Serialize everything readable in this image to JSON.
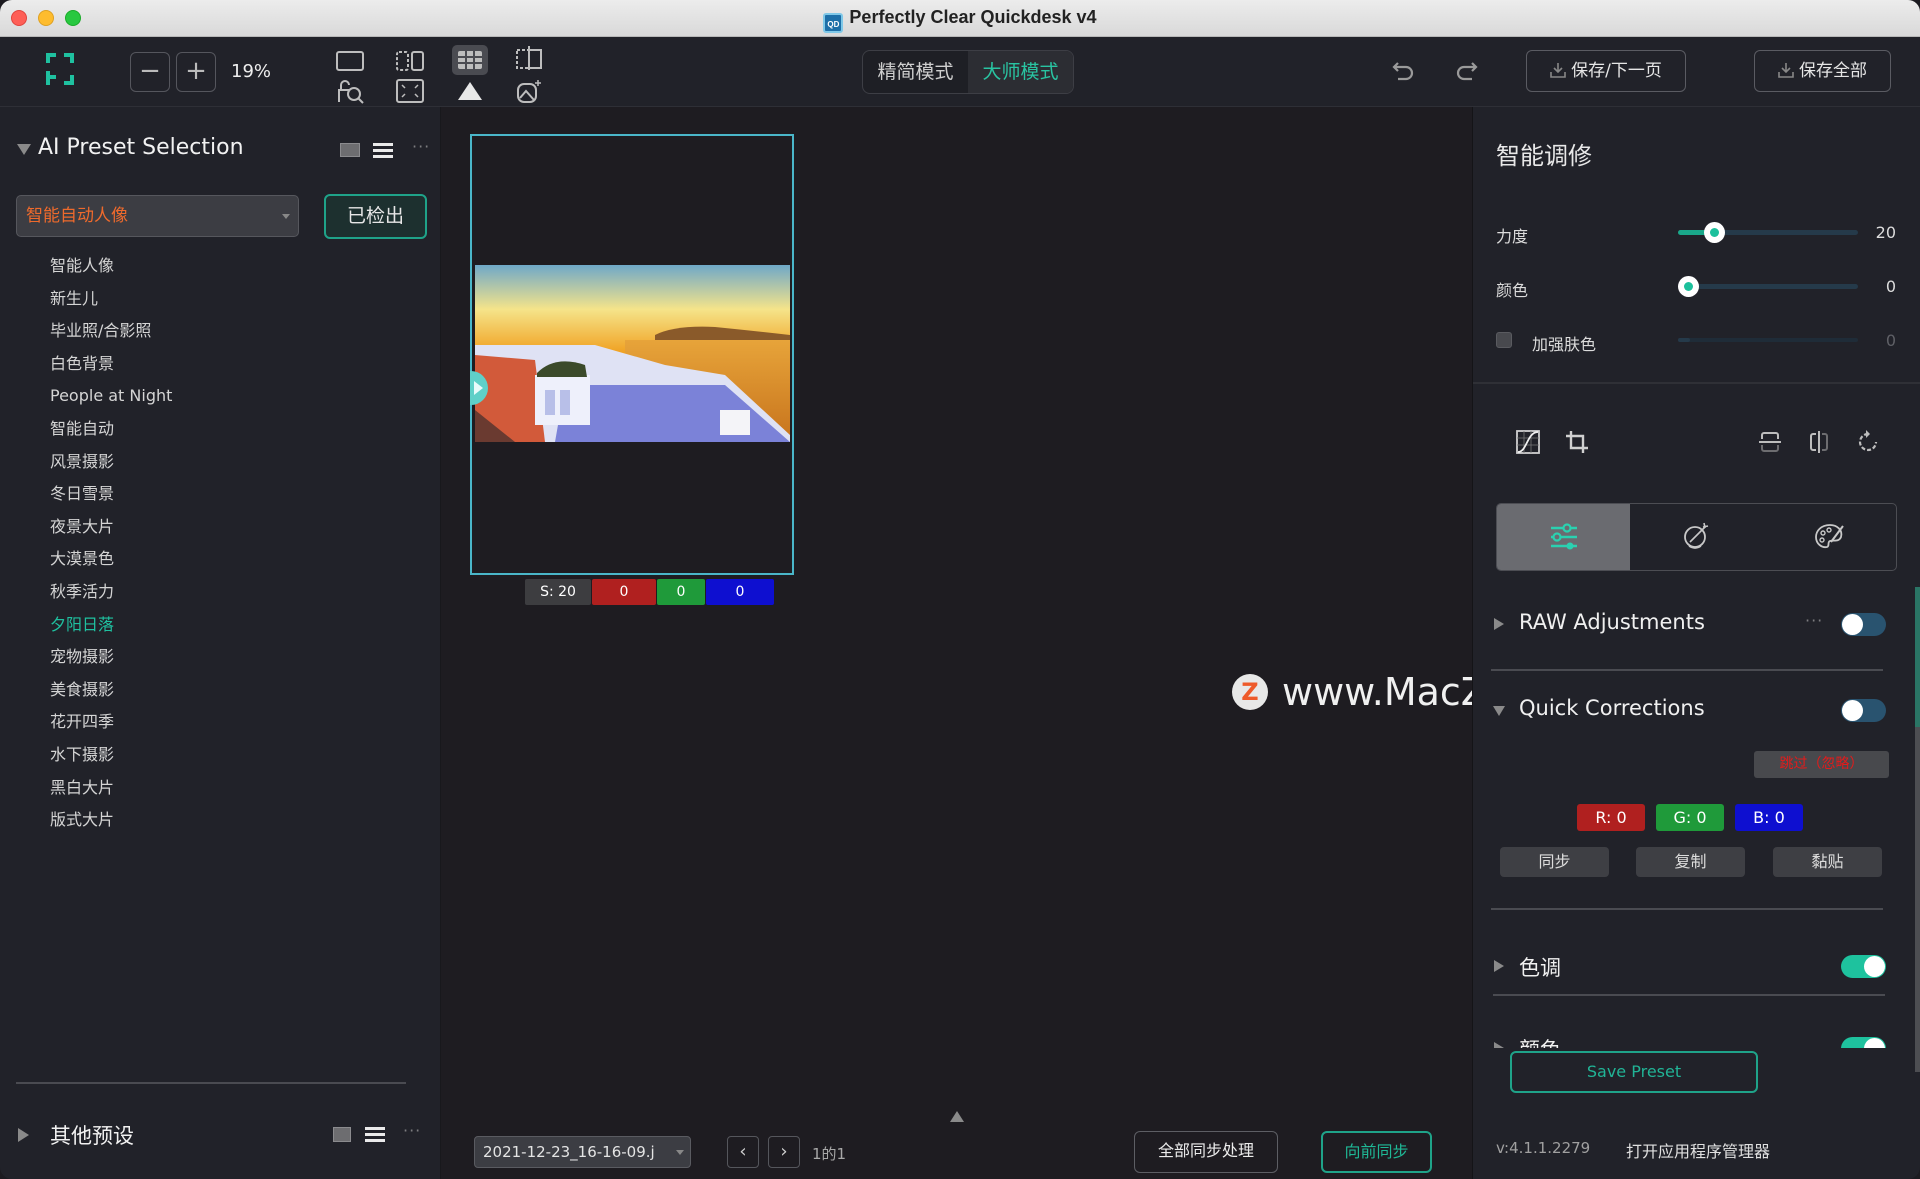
{
  "window": {
    "title": "Perfectly Clear Quickdesk v4",
    "app_icon_text": "QD"
  },
  "toolbar": {
    "zoom_out_label": "−",
    "zoom_in_label": "+",
    "zoom_level": "19%",
    "view_icons": [
      "single-view-icon",
      "compare-view-icon",
      "grid-view-icon",
      "crop-view-icon"
    ],
    "view_sub_icons": [
      "lock-search-icon",
      "fullscreen-icon",
      "triangle-up-icon",
      "image-magic-icon"
    ],
    "modes": [
      {
        "label": "精简模式",
        "active": false
      },
      {
        "label": "大师模式",
        "active": true
      }
    ],
    "undo_icon": "undo-icon",
    "redo_icon": "redo-icon",
    "save_next_label": "保存/下一页",
    "save_all_label": "保存全部"
  },
  "left_panel": {
    "title": "AI Preset Selection",
    "selected_preset": "智能自动人像",
    "detect_button": "已检出",
    "presets": [
      {
        "label": "智能人像",
        "active": false
      },
      {
        "label": "新生儿",
        "active": false
      },
      {
        "label": "毕业照/合影照",
        "active": false
      },
      {
        "label": "白色背景",
        "active": false
      },
      {
        "label": "People at Night",
        "active": false
      },
      {
        "label": "智能自动",
        "active": false
      },
      {
        "label": "风景摄影",
        "active": false
      },
      {
        "label": "冬日雪景",
        "active": false
      },
      {
        "label": "夜景大片",
        "active": false
      },
      {
        "label": "大漠景色",
        "active": false
      },
      {
        "label": "秋季活力",
        "active": false
      },
      {
        "label": "夕阳日落",
        "active": true
      },
      {
        "label": "宠物摄影",
        "active": false
      },
      {
        "label": "美食摄影",
        "active": false
      },
      {
        "label": "花开四季",
        "active": false
      },
      {
        "label": "水下摄影",
        "active": false
      },
      {
        "label": "黑白大片",
        "active": false
      },
      {
        "label": "版式大片",
        "active": false
      }
    ],
    "more_label": "···",
    "other_title": "其他预设"
  },
  "center": {
    "badges": [
      {
        "label": "S: 20",
        "color": "#3d3d40"
      },
      {
        "label": "0",
        "color": "#b0201f"
      },
      {
        "label": "0",
        "color": "#1f9a3a"
      },
      {
        "label": "0",
        "color": "#0e0fd0"
      }
    ],
    "watermark_icon": "Z",
    "watermark_text": "www.MacZ.com",
    "file_name": "2021-12-23_16-16-09.j",
    "prev_label": "‹",
    "next_label": "›",
    "page_info": "1的1",
    "sync_all_label": "全部同步处理",
    "sync_forward_label": "向前同步"
  },
  "right_panel": {
    "title": "智能调修",
    "sliders": [
      {
        "label": "力度",
        "value": "20",
        "fraction": 0.2,
        "enabled": true
      },
      {
        "label": "颜色",
        "value": "0",
        "fraction": 0.0,
        "enabled": true
      },
      {
        "label": "加强肤色",
        "value": "0",
        "fraction": 0.0,
        "enabled": false,
        "checkbox": false
      }
    ],
    "sections": [
      {
        "label": "RAW Adjustments",
        "expanded": false,
        "enabled": false,
        "more": "···"
      },
      {
        "label": "Quick Corrections",
        "expanded": true,
        "enabled": false
      },
      {
        "label": "色调",
        "expanded": false,
        "enabled": true
      },
      {
        "label": "颜色",
        "expanded": false,
        "enabled": true
      }
    ],
    "quick_corrections": {
      "skip_label": "跳过（忽略）",
      "r_label": "R: 0",
      "g_label": "G: 0",
      "b_label": "B: 0",
      "sync_label": "同步",
      "copy_label": "复制",
      "paste_label": "黏贴"
    },
    "save_preset_label": "Save Preset",
    "version": "v:4.1.1.2279",
    "app_manager_label": "打开应用程序管理器"
  },
  "colors": {
    "accent": "#1fc1a0",
    "preset_selected": "#ee6a2c",
    "skip_red": "#e31b1b",
    "r": "#b0201f",
    "g": "#1f9a3a",
    "b": "#0e0fd0"
  }
}
